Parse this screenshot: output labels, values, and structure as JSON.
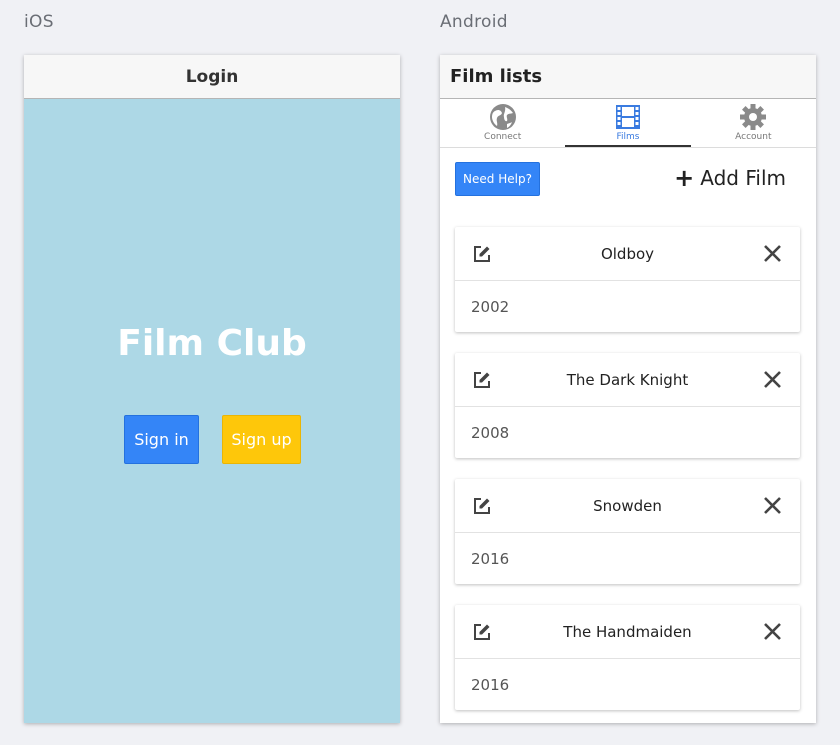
{
  "ios": {
    "platform_label": "iOS",
    "header_title": "Login",
    "app_title": "Film Club",
    "signin_label": "Sign in",
    "signup_label": "Sign up"
  },
  "android": {
    "platform_label": "Android",
    "header_title": "Film lists",
    "tabs": [
      {
        "label": "Connect",
        "icon": "globe-icon"
      },
      {
        "label": "Films",
        "icon": "film-icon"
      },
      {
        "label": "Account",
        "icon": "gear-icon"
      }
    ],
    "active_tab": "Films",
    "help_label": "Need Help?",
    "add_film_label": "Add Film",
    "films": [
      {
        "title": "Oldboy",
        "year": "2002"
      },
      {
        "title": "The Dark Knight",
        "year": "2008"
      },
      {
        "title": "Snowden",
        "year": "2016"
      },
      {
        "title": "The Handmaiden",
        "year": "2016"
      }
    ]
  },
  "colors": {
    "ios_background": "#add8e6",
    "primary_blue": "#3485f7",
    "signup_yellow": "#fec70a",
    "page_background": "#f0f1f5"
  }
}
